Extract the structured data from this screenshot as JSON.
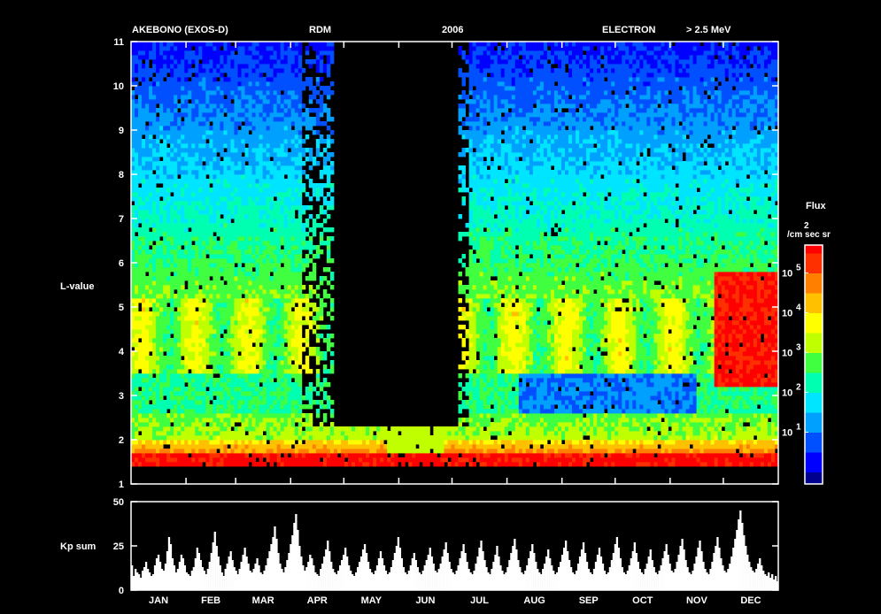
{
  "header": {
    "satellite": "AKEBONO (EXOS-D)",
    "instrument": "RDM",
    "year": "2006",
    "particle": "ELECTRON",
    "energy": "> 2.5 MeV"
  },
  "chart_data": [
    {
      "type": "heatmap",
      "ylabel": "L-value",
      "ylim": [
        1,
        11
      ],
      "yticks": [
        1,
        2,
        3,
        4,
        5,
        6,
        7,
        8,
        9,
        10,
        11
      ],
      "x_range_days": [
        1,
        365
      ],
      "colorbar": {
        "label_line1": "Flux",
        "label_line2": "/cm  sec sr",
        "unit_superscript": "2",
        "scale": "log",
        "range": [
          0.5,
          500000
        ],
        "ticks": [
          {
            "base": "10",
            "exp": "1",
            "value": 10
          },
          {
            "base": "10",
            "exp": "2",
            "value": 100
          },
          {
            "base": "10",
            "exp": "3",
            "value": 1000
          },
          {
            "base": "10",
            "exp": "4",
            "value": 10000
          },
          {
            "base": "10",
            "exp": "5",
            "value": 100000
          }
        ],
        "colors": [
          "#00008f",
          "#0000ff",
          "#0050ff",
          "#00a0ff",
          "#00e5ff",
          "#00ffb0",
          "#40ff40",
          "#c0ff00",
          "#ffff00",
          "#ffc000",
          "#ff8000",
          "#ff3000",
          "#ff0000"
        ]
      }
    },
    {
      "type": "bar",
      "ylabel": "Kp sum",
      "ylim": [
        0,
        50
      ],
      "yticks": [
        0,
        25,
        50
      ],
      "months": [
        "JAN",
        "FEB",
        "MAR",
        "APR",
        "MAY",
        "JUN",
        "JUL",
        "AUG",
        "SEP",
        "OCT",
        "NOV",
        "DEC"
      ],
      "month_start_days": [
        1,
        32,
        60,
        91,
        121,
        152,
        182,
        213,
        244,
        274,
        305,
        335
      ],
      "values": [
        14,
        8,
        12,
        10,
        9,
        7,
        11,
        13,
        16,
        12,
        10,
        8,
        9,
        14,
        18,
        20,
        16,
        12,
        11,
        15,
        22,
        30,
        26,
        18,
        14,
        10,
        12,
        16,
        20,
        18,
        14,
        10,
        9,
        8,
        11,
        13,
        18,
        24,
        21,
        17,
        13,
        11,
        9,
        12,
        16,
        21,
        27,
        33,
        25,
        19,
        14,
        10,
        8,
        12,
        15,
        19,
        22,
        17,
        13,
        11,
        9,
        12,
        16,
        20,
        24,
        19,
        15,
        11,
        10,
        12,
        15,
        18,
        14,
        10,
        9,
        11,
        14,
        18,
        22,
        26,
        30,
        36,
        29,
        21,
        15,
        12,
        10,
        13,
        17,
        21,
        26,
        31,
        38,
        43,
        34,
        25,
        19,
        14,
        11,
        13,
        16,
        20,
        18,
        14,
        10,
        9,
        8,
        12,
        15,
        19,
        23,
        28,
        22,
        16,
        12,
        10,
        9,
        11,
        14,
        17,
        20,
        24,
        19,
        14,
        11,
        9,
        8,
        10,
        13,
        16,
        19,
        23,
        26,
        21,
        16,
        12,
        10,
        9,
        11,
        14,
        18,
        22,
        18,
        14,
        11,
        9,
        10,
        13,
        17,
        21,
        25,
        30,
        24,
        18,
        13,
        10,
        9,
        11,
        14,
        18,
        21,
        17,
        13,
        10,
        9,
        11,
        14,
        17,
        20,
        24,
        19,
        15,
        11,
        10,
        12,
        15,
        19,
        23,
        27,
        21,
        16,
        12,
        10,
        9,
        11,
        14,
        18,
        22,
        26,
        21,
        16,
        12,
        10,
        9,
        11,
        15,
        19,
        24,
        28,
        22,
        17,
        13,
        10,
        9,
        12,
        16,
        20,
        25,
        19,
        14,
        11,
        9,
        10,
        13,
        17,
        21,
        25,
        29,
        23,
        17,
        13,
        10,
        9,
        11,
        14,
        18,
        22,
        26,
        21,
        16,
        12,
        10,
        9,
        12,
        15,
        19,
        23,
        18,
        14,
        11,
        9,
        10,
        13,
        16,
        20,
        24,
        28,
        22,
        17,
        13,
        10,
        9,
        11,
        15,
        19,
        23,
        27,
        21,
        16,
        12,
        10,
        9,
        12,
        16,
        20,
        24,
        19,
        15,
        11,
        9,
        10,
        13,
        17,
        21,
        26,
        30,
        24,
        18,
        13,
        10,
        9,
        11,
        14,
        18,
        22,
        27,
        21,
        16,
        12,
        10,
        9,
        12,
        15,
        19,
        23,
        17,
        13,
        10,
        9,
        11,
        14,
        18,
        22,
        26,
        20,
        15,
        11,
        10,
        12,
        16,
        20,
        25,
        29,
        23,
        17,
        13,
        10,
        9,
        11,
        15,
        19,
        24,
        28,
        22,
        16,
        12,
        10,
        9,
        12,
        16,
        21,
        25,
        30,
        24,
        18,
        14,
        11,
        10,
        12,
        15,
        19,
        24,
        29,
        34,
        40,
        45,
        38,
        31,
        25,
        20,
        16,
        13,
        11,
        10,
        12,
        15,
        18,
        14,
        11,
        9,
        8,
        10,
        7,
        9,
        6,
        8,
        5
      ]
    }
  ]
}
